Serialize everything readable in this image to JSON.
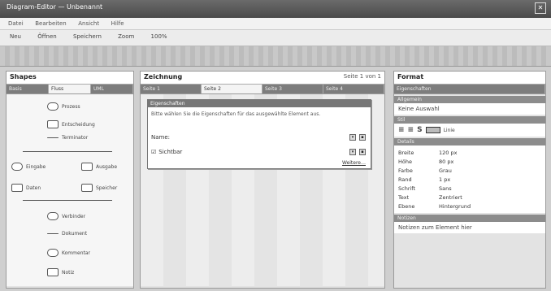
{
  "window": {
    "title": "Diagram-Editor — Unbenannt",
    "close_glyph": "✕"
  },
  "menubar": {
    "items": [
      "Datei",
      "Bearbeiten",
      "Ansicht",
      "Hilfe"
    ]
  },
  "toolbar": {
    "items": [
      "Neu",
      "Öffnen",
      "Speichern",
      "Zoom",
      "100%"
    ]
  },
  "palette": {
    "title": "Shapes",
    "tabs": [
      "Basis",
      "Fluss",
      "UML"
    ],
    "shapes": [
      {
        "label": "Prozess",
        "kind": "rect"
      },
      {
        "label": "Entscheidung",
        "kind": "round"
      },
      {
        "label": "Terminator",
        "kind": "line"
      },
      {
        "label": "Eingabe",
        "kind": "rect"
      },
      {
        "label": "Ausgabe",
        "kind": "rect"
      },
      {
        "label": "Daten",
        "kind": "rect"
      },
      {
        "label": "Speicher",
        "kind": "rect"
      },
      {
        "label": "Verbinder",
        "kind": "round"
      },
      {
        "label": "Dokument",
        "kind": "line"
      },
      {
        "label": "Kommentar",
        "kind": "round"
      },
      {
        "label": "Notiz",
        "kind": "rect"
      }
    ]
  },
  "canvas": {
    "title": "Zeichnung",
    "subtitle": "Seite 1 von 1",
    "tabs": [
      "Seite 1",
      "Seite 2",
      "Seite 3",
      "Seite 4"
    ],
    "dialog": {
      "title": "Eigenschaften",
      "text": "Bitte wählen Sie die Eigenschaften für das ausgewählte Element aus.",
      "field1_label": "Name:",
      "field2_label": "Sichtbar",
      "link": "Weitere…"
    }
  },
  "properties": {
    "title": "Format",
    "tab": "Eigenschaften",
    "sections": {
      "general": "Allgemein",
      "general_text": "Keine Auswahl",
      "style": "Stil",
      "style_label": "Linie",
      "details": "Details"
    },
    "rows": [
      {
        "k": "Breite",
        "v": "120 px"
      },
      {
        "k": "Höhe",
        "v": "80 px"
      },
      {
        "k": "Farbe",
        "v": "Grau"
      },
      {
        "k": "Rand",
        "v": "1 px"
      },
      {
        "k": "Schrift",
        "v": "Sans"
      },
      {
        "k": "Text",
        "v": "Zentriert"
      },
      {
        "k": "Ebene",
        "v": "Hintergrund"
      }
    ],
    "footer_section": "Notizen",
    "footer_text": "Notizen zum Element hier"
  }
}
